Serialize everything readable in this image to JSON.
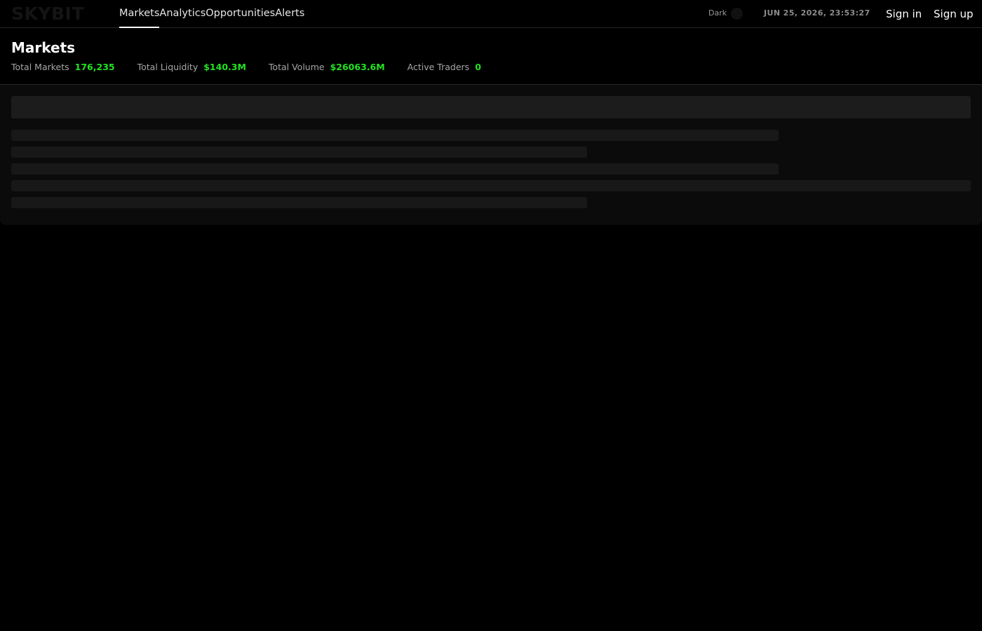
{
  "brand": {
    "logo_text": "SKYBIT"
  },
  "nav": {
    "items": [
      {
        "label": "Markets",
        "active": true
      },
      {
        "label": "Analytics",
        "active": false
      },
      {
        "label": "Opportunities",
        "active": false
      },
      {
        "label": "Alerts",
        "active": false
      }
    ]
  },
  "theme": {
    "label": "Dark"
  },
  "clock": {
    "datetime": "JUN 25, 2026, 23:53:27"
  },
  "auth": {
    "sign_in": "Sign in",
    "sign_up": "Sign up"
  },
  "page": {
    "title": "Markets",
    "stats": [
      {
        "label": "Total Markets",
        "value": "176,235"
      },
      {
        "label": "Total Liquidity",
        "value": "$140.3M"
      },
      {
        "label": "Total Volume",
        "value": "$26063.6M"
      },
      {
        "label": "Active Traders",
        "value": "0"
      }
    ]
  },
  "colors": {
    "background": "#000000",
    "accent_green": "#22e222",
    "skeleton": "#1c1c1c"
  },
  "icons": {
    "theme_toggle": "dark-mode-toggle-icon"
  }
}
